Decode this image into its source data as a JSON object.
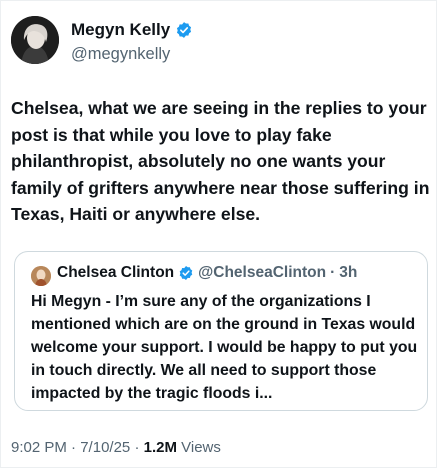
{
  "author": {
    "name": "Megyn Kelly",
    "handle": "@megynkelly",
    "verified_color": "#1d9bf0"
  },
  "tweet": {
    "text": "Chelsea, what we are seeing in the replies to your post is that while you love to play fake philanthropist, absolutely no one wants your family of grifters anywhere near those suffering in Texas, Haiti or anywhere else."
  },
  "quoted": {
    "name": "Chelsea Clinton",
    "handle": "@ChelseaClinton",
    "separator": "·",
    "time": "3h",
    "text": "Hi Megyn - I’m sure any of the organizations I mentioned which are on the ground in Texas would welcome your support. I would be happy to put you in touch directly. We all need to support those impacted by the tragic floods i..."
  },
  "meta": {
    "time": "9:02 PM",
    "date": "7/10/25",
    "separator": "·",
    "views_count": "1.2M",
    "views_label": "Views"
  }
}
